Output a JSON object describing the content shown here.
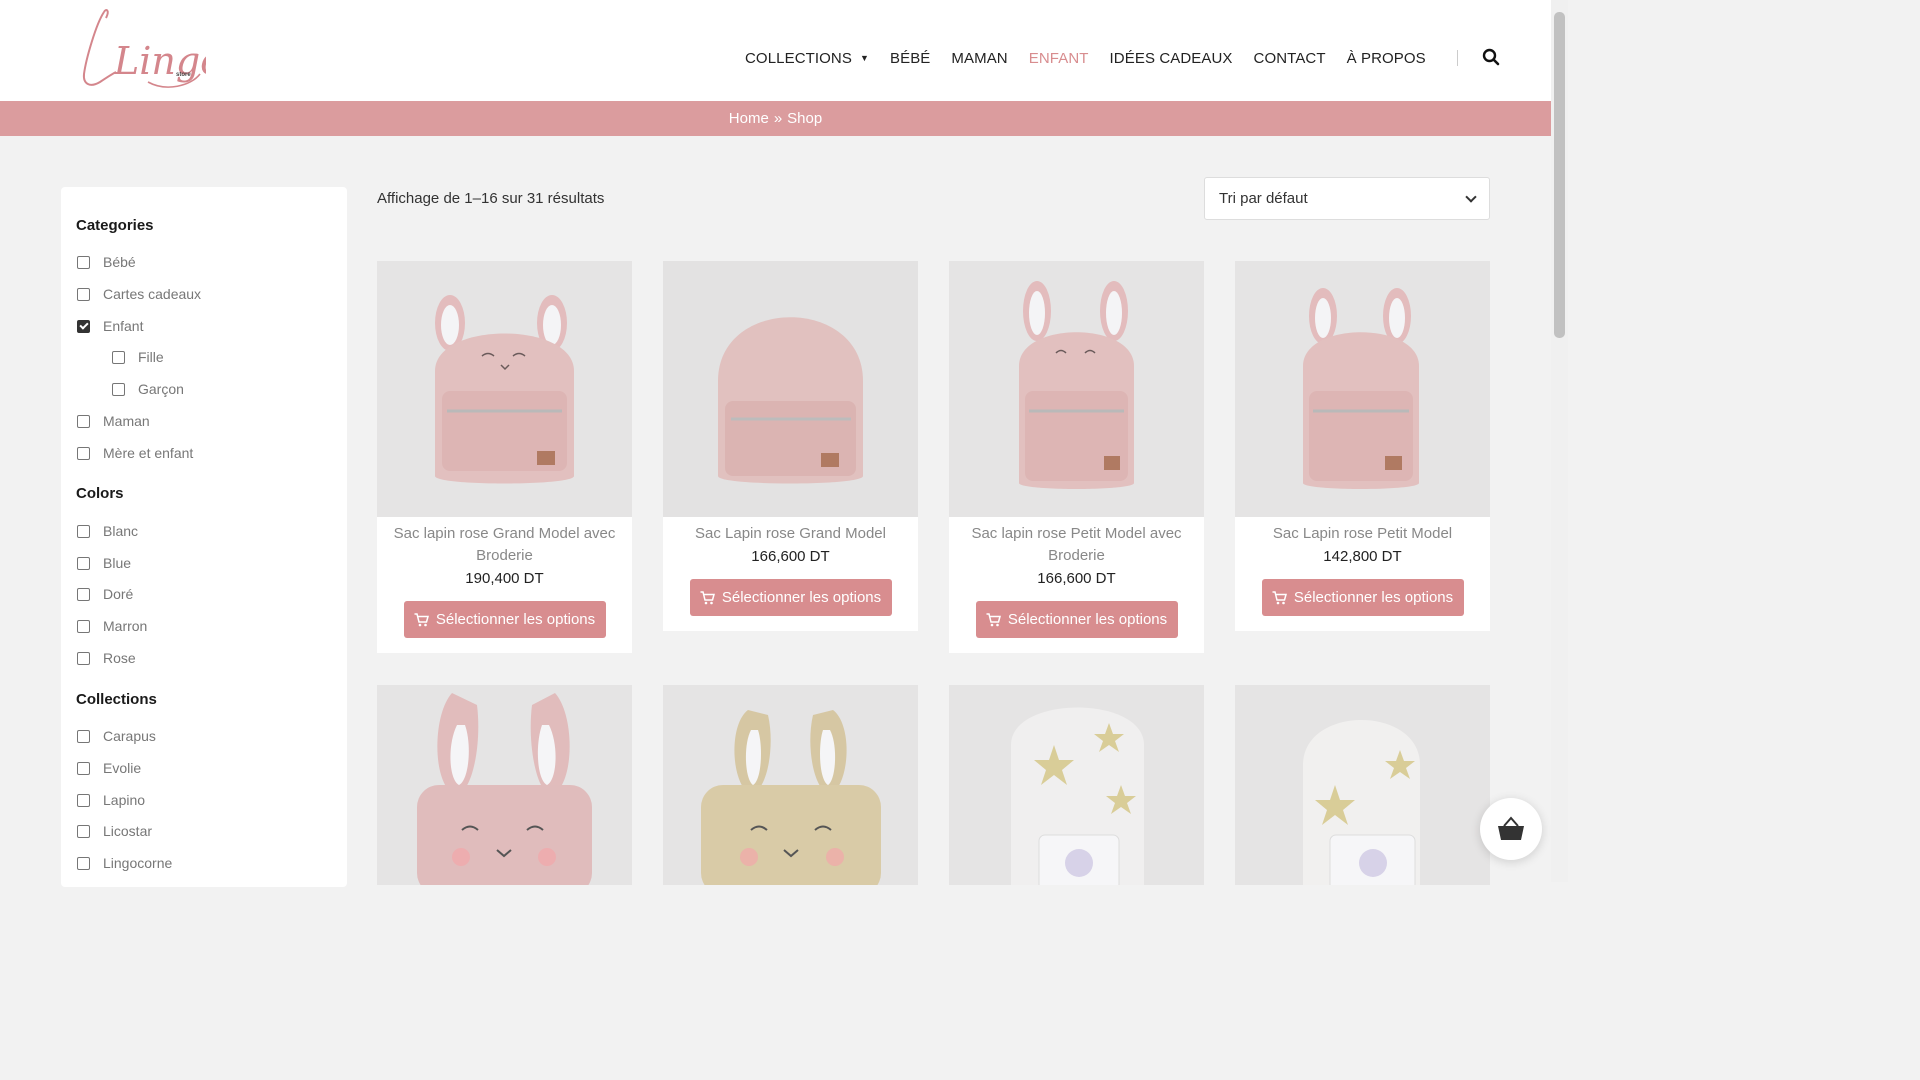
{
  "brand": {
    "logo_text": "Lingo",
    "logo_sub": "store"
  },
  "nav": {
    "items": [
      {
        "label": "COLLECTIONS",
        "has_caret": true
      },
      {
        "label": "BÉBÉ"
      },
      {
        "label": "MAMAN"
      },
      {
        "label": "ENFANT",
        "active": true
      },
      {
        "label": "IDÉES CADEAUX"
      },
      {
        "label": "CONTACT"
      },
      {
        "label": "À PROPOS"
      }
    ],
    "search_icon": "search-icon"
  },
  "breadcrumb": {
    "home": "Home",
    "separator": "»",
    "current": "Shop"
  },
  "sidebar": {
    "categories_title": "Categories",
    "categories": [
      "Bébé",
      "Cartes cadeaux",
      "Enfant",
      "Fille",
      "Garçon",
      "Maman",
      "Mère et enfant"
    ],
    "colors_title": "Colors",
    "colors": [
      "Blanc",
      "Blue",
      "Doré",
      "Marron",
      "Rose"
    ],
    "collections_title": "Collections",
    "collections": [
      "Carapus",
      "Evolie",
      "Lapino",
      "Licostar",
      "Lingocorne"
    ]
  },
  "results": {
    "count_text": "Affichage de 1–16 sur 31 résultats",
    "sort_value": "Tri par défaut"
  },
  "products": [
    {
      "title": "Sac lapin rose Grand Model avec Broderie",
      "price": "190,400 DT",
      "button": "Sélectionner les options"
    },
    {
      "title": "Sac Lapin rose Grand Model",
      "price": "166,600 DT",
      "button": "Sélectionner les options"
    },
    {
      "title": "Sac lapin rose Petit Model avec Broderie",
      "price": "166,600 DT",
      "button": "Sélectionner les options"
    },
    {
      "title": "Sac Lapin rose Petit Model",
      "price": "142,800 DT",
      "button": "Sélectionner les options"
    }
  ],
  "colors": {
    "accent": "#d88d8f",
    "band": "#db9c9e",
    "background": "#f2f2f2"
  }
}
